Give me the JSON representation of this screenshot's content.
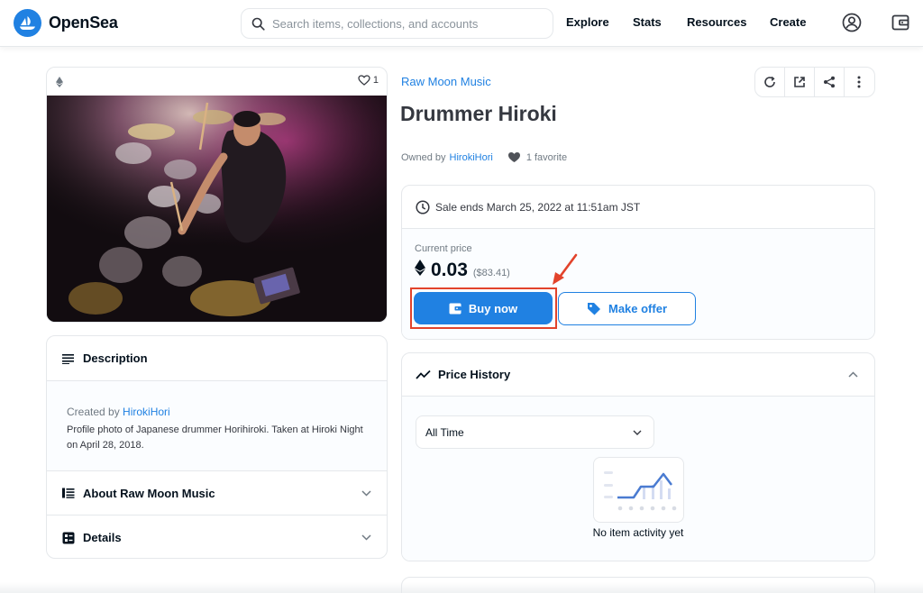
{
  "header": {
    "brand": "OpenSea",
    "search_placeholder": "Search items, collections, and accounts",
    "nav": [
      "Explore",
      "Stats",
      "Resources",
      "Create"
    ]
  },
  "media": {
    "favorite_count": "1"
  },
  "description_panel": {
    "title": "Description",
    "created_by_label": "Created by",
    "creator": "HirokiHori",
    "text": "Profile photo of Japanese drummer Horihiroki. Taken at Hiroki Night on April 28, 2018."
  },
  "about_panel": {
    "title": "About Raw Moon Music"
  },
  "details_panel": {
    "title": "Details"
  },
  "item": {
    "collection": "Raw Moon Music",
    "title": "Drummer Hiroki",
    "owned_by_label": "Owned by",
    "owner": "HirokiHori",
    "favorites": "1 favorite"
  },
  "sale": {
    "ends_text": "Sale ends March 25, 2022 at 11:51am JST",
    "current_price_label": "Current price",
    "price": "0.03",
    "price_usd": "($83.41)",
    "buy_label": "Buy now",
    "offer_label": "Make offer"
  },
  "history": {
    "title": "Price History",
    "range": "All Time",
    "empty_text": "No item activity yet"
  },
  "colors": {
    "accent": "#2081e2",
    "highlight": "#e2432b"
  }
}
